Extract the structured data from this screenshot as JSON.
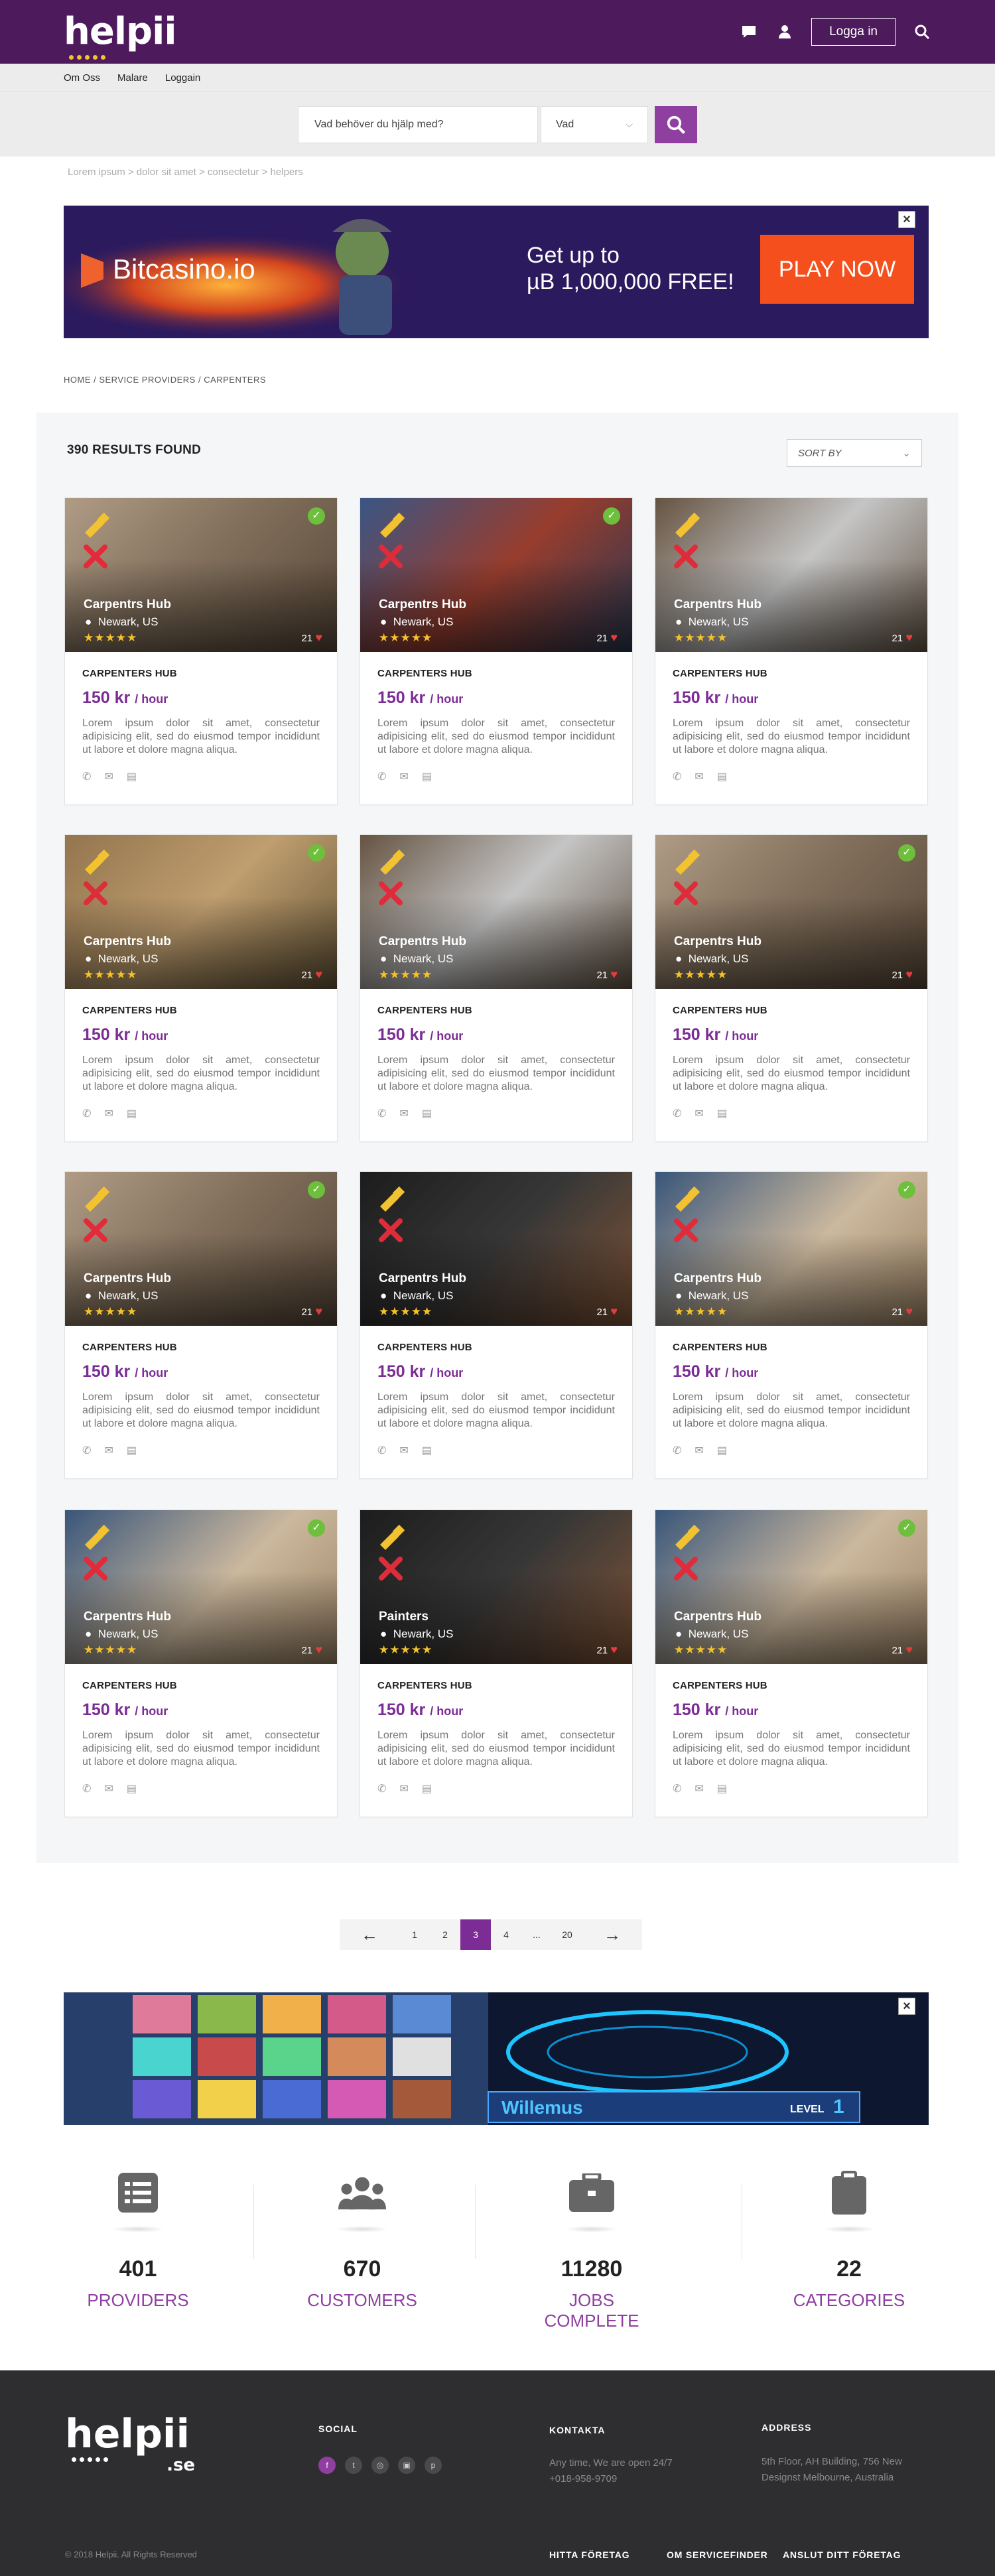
{
  "header": {
    "logo_text": "helpii",
    "login_label": "Logga in"
  },
  "subnav": [
    "Om Oss",
    "Malare",
    "Loggain"
  ],
  "search": {
    "placeholder": "Vad behöver du hjälp med?",
    "select_value": "Vad"
  },
  "breadcrumb_top": "Lorem ipsum > dolor sit amet > consectetur > helpers",
  "ad_top": {
    "brand": "Bitcasino.io",
    "headline_line1": "Get up to",
    "headline_line2": "µB 1,000,000 FREE!",
    "cta": "PLAY NOW",
    "close": "×"
  },
  "breadcrumb": "HOME  /  SERVICE PROVIDERS  /  CARPENTERS",
  "results": {
    "count_text": "390 RESULTS FOUND",
    "sort_label": "SORT BY"
  },
  "cards": [
    {
      "name": "Carpentrs Hub",
      "location": "Newark, US",
      "count": "21",
      "title": "CARPENTERS HUB",
      "price": "150 kr",
      "unit": "/ hour",
      "desc": "Lorem ipsum dolor sit amet, consectetur adipisicing elit, sed do eiusmod tempor incididunt ut labore et dolore magna aliqua.",
      "scene": "worker"
    },
    {
      "name": "Carpentrs Hub",
      "location": "Newark, US",
      "count": "21",
      "title": "CARPENTERS HUB",
      "price": "150 kr",
      "unit": "/ hour",
      "desc": "Lorem ipsum dolor sit amet, consectetur adipisicing elit, sed do eiusmod tempor incididunt ut labore et dolore magna aliqua.",
      "scene": "woman"
    },
    {
      "name": "Carpentrs Hub",
      "location": "Newark, US",
      "count": "21",
      "title": "CARPENTERS HUB",
      "price": "150 kr",
      "unit": "/ hour",
      "desc": "Lorem ipsum dolor sit amet, consectetur adipisicing elit, sed do eiusmod tempor incididunt ut labore et dolore magna aliqua.",
      "scene": "saw"
    },
    {
      "name": "Carpentrs Hub",
      "location": "Newark, US",
      "count": "21",
      "title": "CARPENTERS HUB",
      "price": "150 kr",
      "unit": "/ hour",
      "desc": "Lorem ipsum dolor sit amet, consectetur adipisicing elit, sed do eiusmod tempor incididunt ut labore et dolore magna aliqua.",
      "scene": "site"
    },
    {
      "name": "Carpentrs Hub",
      "location": "Newark, US",
      "count": "21",
      "title": "CARPENTERS HUB",
      "price": "150 kr",
      "unit": "/ hour",
      "desc": "Lorem ipsum dolor sit amet, consectetur adipisicing elit, sed do eiusmod tempor incididunt ut labore et dolore magna aliqua.",
      "scene": "saw"
    },
    {
      "name": "Carpentrs Hub",
      "location": "Newark, US",
      "count": "21",
      "title": "CARPENTERS HUB",
      "price": "150 kr",
      "unit": "/ hour",
      "desc": "Lorem ipsum dolor sit amet, consectetur adipisicing elit, sed do eiusmod tempor incididunt ut labore et dolore magna aliqua.",
      "scene": "worker"
    },
    {
      "name": "Carpentrs Hub",
      "location": "Newark, US",
      "count": "21",
      "title": "CARPENTERS HUB",
      "price": "150 kr",
      "unit": "/ hour",
      "desc": "Lorem ipsum dolor sit amet, consectetur adipisicing elit, sed do eiusmod tempor incididunt ut labore et dolore magna aliqua.",
      "scene": "worker"
    },
    {
      "name": "Carpentrs Hub",
      "location": "Newark, US",
      "count": "21",
      "title": "CARPENTERS HUB",
      "price": "150 kr",
      "unit": "/ hour",
      "desc": "Lorem ipsum dolor sit amet, consectetur adipisicing elit, sed do eiusmod tempor incididunt ut labore et dolore magna aliqua.",
      "scene": "drill"
    },
    {
      "name": "Carpentrs Hub",
      "location": "Newark, US",
      "count": "21",
      "title": "CARPENTERS HUB",
      "price": "150 kr",
      "unit": "/ hour",
      "desc": "Lorem ipsum dolor sit amet, consectetur adipisicing elit, sed do eiusmod tempor incididunt ut labore et dolore magna aliqua.",
      "scene": "measure"
    },
    {
      "name": "Carpentrs Hub",
      "location": "Newark, US",
      "count": "21",
      "title": "CARPENTERS HUB",
      "price": "150 kr",
      "unit": "/ hour",
      "desc": "Lorem ipsum dolor sit amet, consectetur adipisicing elit, sed do eiusmod tempor incididunt ut labore et dolore magna aliqua.",
      "scene": "measure"
    },
    {
      "name": "Painters",
      "location": "Newark, US",
      "count": "21",
      "title": "CARPENTERS HUB",
      "price": "150 kr",
      "unit": "/ hour",
      "desc": "Lorem ipsum dolor sit amet, consectetur adipisicing elit, sed do eiusmod tempor incididunt ut labore et dolore magna aliqua.",
      "scene": "drill"
    },
    {
      "name": "Carpentrs Hub",
      "location": "Newark, US",
      "count": "21",
      "title": "CARPENTERS HUB",
      "price": "150 kr",
      "unit": "/ hour",
      "desc": "Lorem ipsum dolor sit amet, consectetur adipisicing elit, sed do eiusmod tempor incididunt ut labore et dolore magna aliqua.",
      "scene": "measure"
    }
  ],
  "pagination": {
    "prev": "←",
    "next": "→",
    "pages": [
      "1",
      "2",
      "3",
      "4",
      "...",
      "20"
    ],
    "active": "3"
  },
  "ad_bottom": {
    "player_name": "Willemus",
    "level_label": "LEVEL",
    "level_value": "1",
    "close": "×"
  },
  "stats": [
    {
      "num": "401",
      "label": "PROVIDERS",
      "icon": "list-icon"
    },
    {
      "num": "670",
      "label": "CUSTOMERS",
      "icon": "users-icon"
    },
    {
      "num": "11280",
      "label": "JOBS COMPLETE",
      "icon": "briefcase-icon"
    },
    {
      "num": "22",
      "label": "CATEGORIES",
      "icon": "clipboard-icon"
    }
  ],
  "footer": {
    "logo_text": "helpii",
    "logo_suffix": ".se",
    "social_heading": "SOCIAL",
    "contact_heading": "KONTAKTA",
    "contact_line1": "Any time, We are open 24/7",
    "contact_line2": "+018-958-9709",
    "address_heading": "ADDRESS",
    "address_line1": "5th Floor, AH Building, 756 New",
    "address_line2": "Designst Melbourne, Australia",
    "copyright": "© 2018 Helpii. All Rights Reserved",
    "links": [
      "HITTA FÖRETAG",
      "OM SERVICEFINDER",
      "ANSLUT DITT FÖRETAG"
    ]
  },
  "colors": {
    "brand_purple": "#4d1a5c",
    "accent_purple": "#8e3fa0",
    "star_yellow": "#f6c22a",
    "verified_green": "#6dbf3c",
    "heart_red": "#e23c3c"
  }
}
